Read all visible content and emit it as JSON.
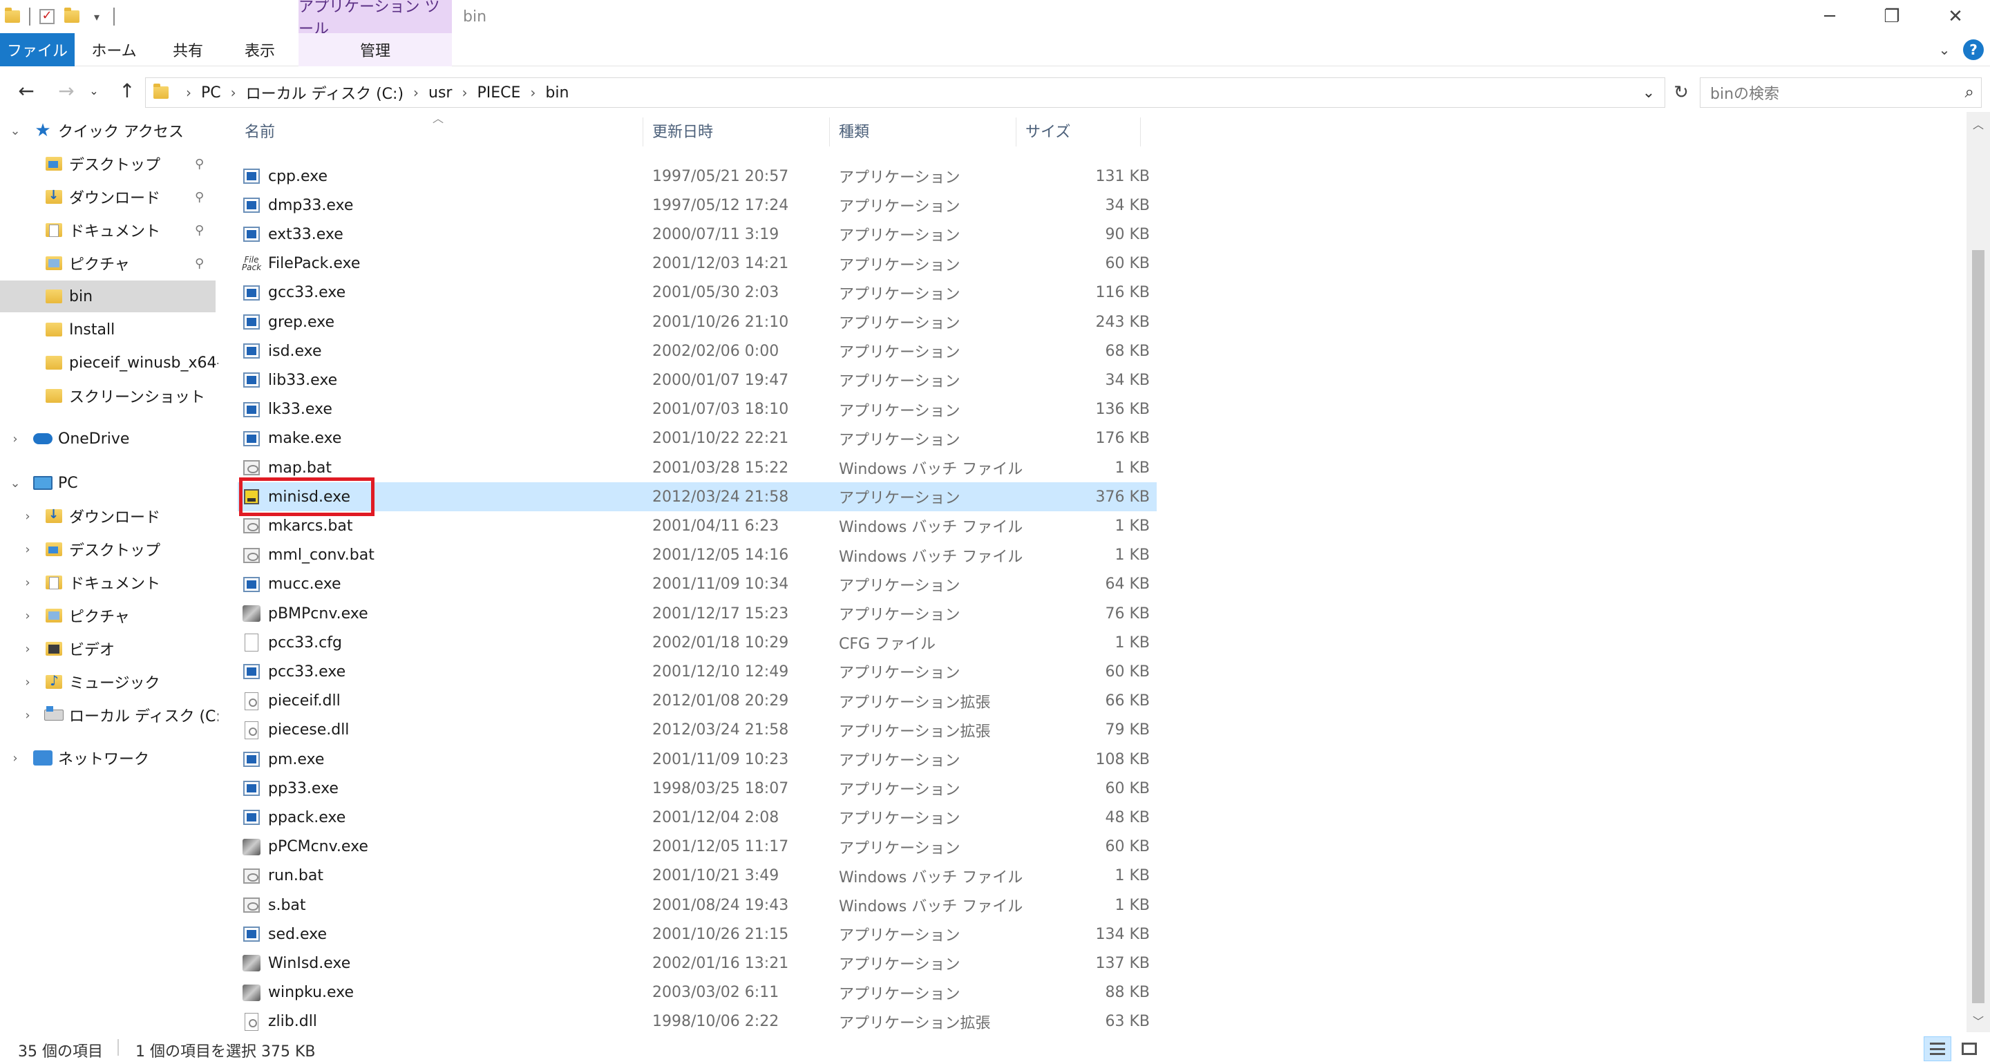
{
  "window": {
    "context_tab_header": "アプリケーション ツール",
    "title": "bin"
  },
  "ribbon": {
    "tabs": [
      "ファイル",
      "ホーム",
      "共有",
      "表示",
      "管理"
    ]
  },
  "address": {
    "crumbs": [
      "PC",
      "ローカル ディスク (C:)",
      "usr",
      "PIECE",
      "bin"
    ],
    "search_placeholder": "binの検索"
  },
  "nav": {
    "quick_access": "クイック アクセス",
    "quick_items": [
      "デスクトップ",
      "ダウンロード",
      "ドキュメント",
      "ピクチャ",
      "bin",
      "Install",
      "pieceif_winusb_x64-",
      "スクリーンショット"
    ],
    "onedrive": "OneDrive",
    "pc": "PC",
    "pc_items": [
      "ダウンロード",
      "デスクトップ",
      "ドキュメント",
      "ピクチャ",
      "ビデオ",
      "ミュージック",
      "ローカル ディスク (C:)"
    ],
    "network": "ネットワーク"
  },
  "columns": {
    "name": "名前",
    "date": "更新日時",
    "type": "種類",
    "size": "サイズ"
  },
  "files": [
    {
      "name": "cpp.exe",
      "date": "1997/05/21 20:57",
      "type": "アプリケーション",
      "size": "131 KB",
      "icon": "exe-icon"
    },
    {
      "name": "dmp33.exe",
      "date": "1997/05/12 17:24",
      "type": "アプリケーション",
      "size": "34 KB",
      "icon": "exe-icon"
    },
    {
      "name": "ext33.exe",
      "date": "2000/07/11 3:19",
      "type": "アプリケーション",
      "size": "90 KB",
      "icon": "exe-icon"
    },
    {
      "name": "FilePack.exe",
      "date": "2001/12/03 14:21",
      "type": "アプリケーション",
      "size": "60 KB",
      "icon": "filepack-icon"
    },
    {
      "name": "gcc33.exe",
      "date": "2001/05/30 2:03",
      "type": "アプリケーション",
      "size": "116 KB",
      "icon": "exe-icon"
    },
    {
      "name": "grep.exe",
      "date": "2001/10/26 21:10",
      "type": "アプリケーション",
      "size": "243 KB",
      "icon": "exe-icon"
    },
    {
      "name": "isd.exe",
      "date": "2002/02/06 0:00",
      "type": "アプリケーション",
      "size": "68 KB",
      "icon": "exe-icon"
    },
    {
      "name": "lib33.exe",
      "date": "2000/01/07 19:47",
      "type": "アプリケーション",
      "size": "34 KB",
      "icon": "exe-icon"
    },
    {
      "name": "lk33.exe",
      "date": "2001/07/03 18:10",
      "type": "アプリケーション",
      "size": "136 KB",
      "icon": "exe-icon"
    },
    {
      "name": "make.exe",
      "date": "2001/10/22 22:21",
      "type": "アプリケーション",
      "size": "176 KB",
      "icon": "exe-icon"
    },
    {
      "name": "map.bat",
      "date": "2001/03/28 15:22",
      "type": "Windows バッチ ファイル",
      "size": "1 KB",
      "icon": "bat-icon"
    },
    {
      "name": "minisd.exe",
      "date": "2012/03/24 21:58",
      "type": "アプリケーション",
      "size": "376 KB",
      "icon": "minisd-icon"
    },
    {
      "name": "mkarcs.bat",
      "date": "2001/04/11 6:23",
      "type": "Windows バッチ ファイル",
      "size": "1 KB",
      "icon": "bat-icon"
    },
    {
      "name": "mml_conv.bat",
      "date": "2001/12/05 14:16",
      "type": "Windows バッチ ファイル",
      "size": "1 KB",
      "icon": "bat-icon"
    },
    {
      "name": "mucc.exe",
      "date": "2001/11/09 10:34",
      "type": "アプリケーション",
      "size": "64 KB",
      "icon": "exe-icon"
    },
    {
      "name": "pBMPcnv.exe",
      "date": "2001/12/17 15:23",
      "type": "アプリケーション",
      "size": "76 KB",
      "icon": "tool-icon"
    },
    {
      "name": "pcc33.cfg",
      "date": "2002/01/18 10:29",
      "type": "CFG ファイル",
      "size": "1 KB",
      "icon": "cfg-icon"
    },
    {
      "name": "pcc33.exe",
      "date": "2001/12/10 12:49",
      "type": "アプリケーション",
      "size": "60 KB",
      "icon": "exe-icon"
    },
    {
      "name": "pieceif.dll",
      "date": "2012/01/08 20:29",
      "type": "アプリケーション拡張",
      "size": "66 KB",
      "icon": "dll-icon"
    },
    {
      "name": "piecese.dll",
      "date": "2012/03/24 21:58",
      "type": "アプリケーション拡張",
      "size": "79 KB",
      "icon": "dll-icon"
    },
    {
      "name": "pm.exe",
      "date": "2001/11/09 10:23",
      "type": "アプリケーション",
      "size": "108 KB",
      "icon": "exe-icon"
    },
    {
      "name": "pp33.exe",
      "date": "1998/03/25 18:07",
      "type": "アプリケーション",
      "size": "60 KB",
      "icon": "exe-icon"
    },
    {
      "name": "ppack.exe",
      "date": "2001/12/04 2:08",
      "type": "アプリケーション",
      "size": "48 KB",
      "icon": "exe-icon"
    },
    {
      "name": "pPCMcnv.exe",
      "date": "2001/12/05 11:17",
      "type": "アプリケーション",
      "size": "60 KB",
      "icon": "tool-icon"
    },
    {
      "name": "run.bat",
      "date": "2001/10/21 3:49",
      "type": "Windows バッチ ファイル",
      "size": "1 KB",
      "icon": "bat-icon"
    },
    {
      "name": "s.bat",
      "date": "2001/08/24 19:43",
      "type": "Windows バッチ ファイル",
      "size": "1 KB",
      "icon": "bat-icon"
    },
    {
      "name": "sed.exe",
      "date": "2001/10/26 21:15",
      "type": "アプリケーション",
      "size": "134 KB",
      "icon": "exe-icon"
    },
    {
      "name": "WinIsd.exe",
      "date": "2002/01/16 13:21",
      "type": "アプリケーション",
      "size": "137 KB",
      "icon": "tool-icon"
    },
    {
      "name": "winpku.exe",
      "date": "2003/03/02 6:11",
      "type": "アプリケーション",
      "size": "88 KB",
      "icon": "tool-icon"
    },
    {
      "name": "zlib.dll",
      "date": "1998/10/06 2:22",
      "type": "アプリケーション拡張",
      "size": "63 KB",
      "icon": "dll-icon"
    }
  ],
  "selected_file": "minisd.exe",
  "status": {
    "item_count": "35 個の項目",
    "selection": "1 個の項目を選択  375 KB"
  },
  "colors": {
    "accent": "#1979ca",
    "selection": "#cce8ff",
    "highlight_box": "#e01b24",
    "context_tab": "#e8d4f5"
  }
}
